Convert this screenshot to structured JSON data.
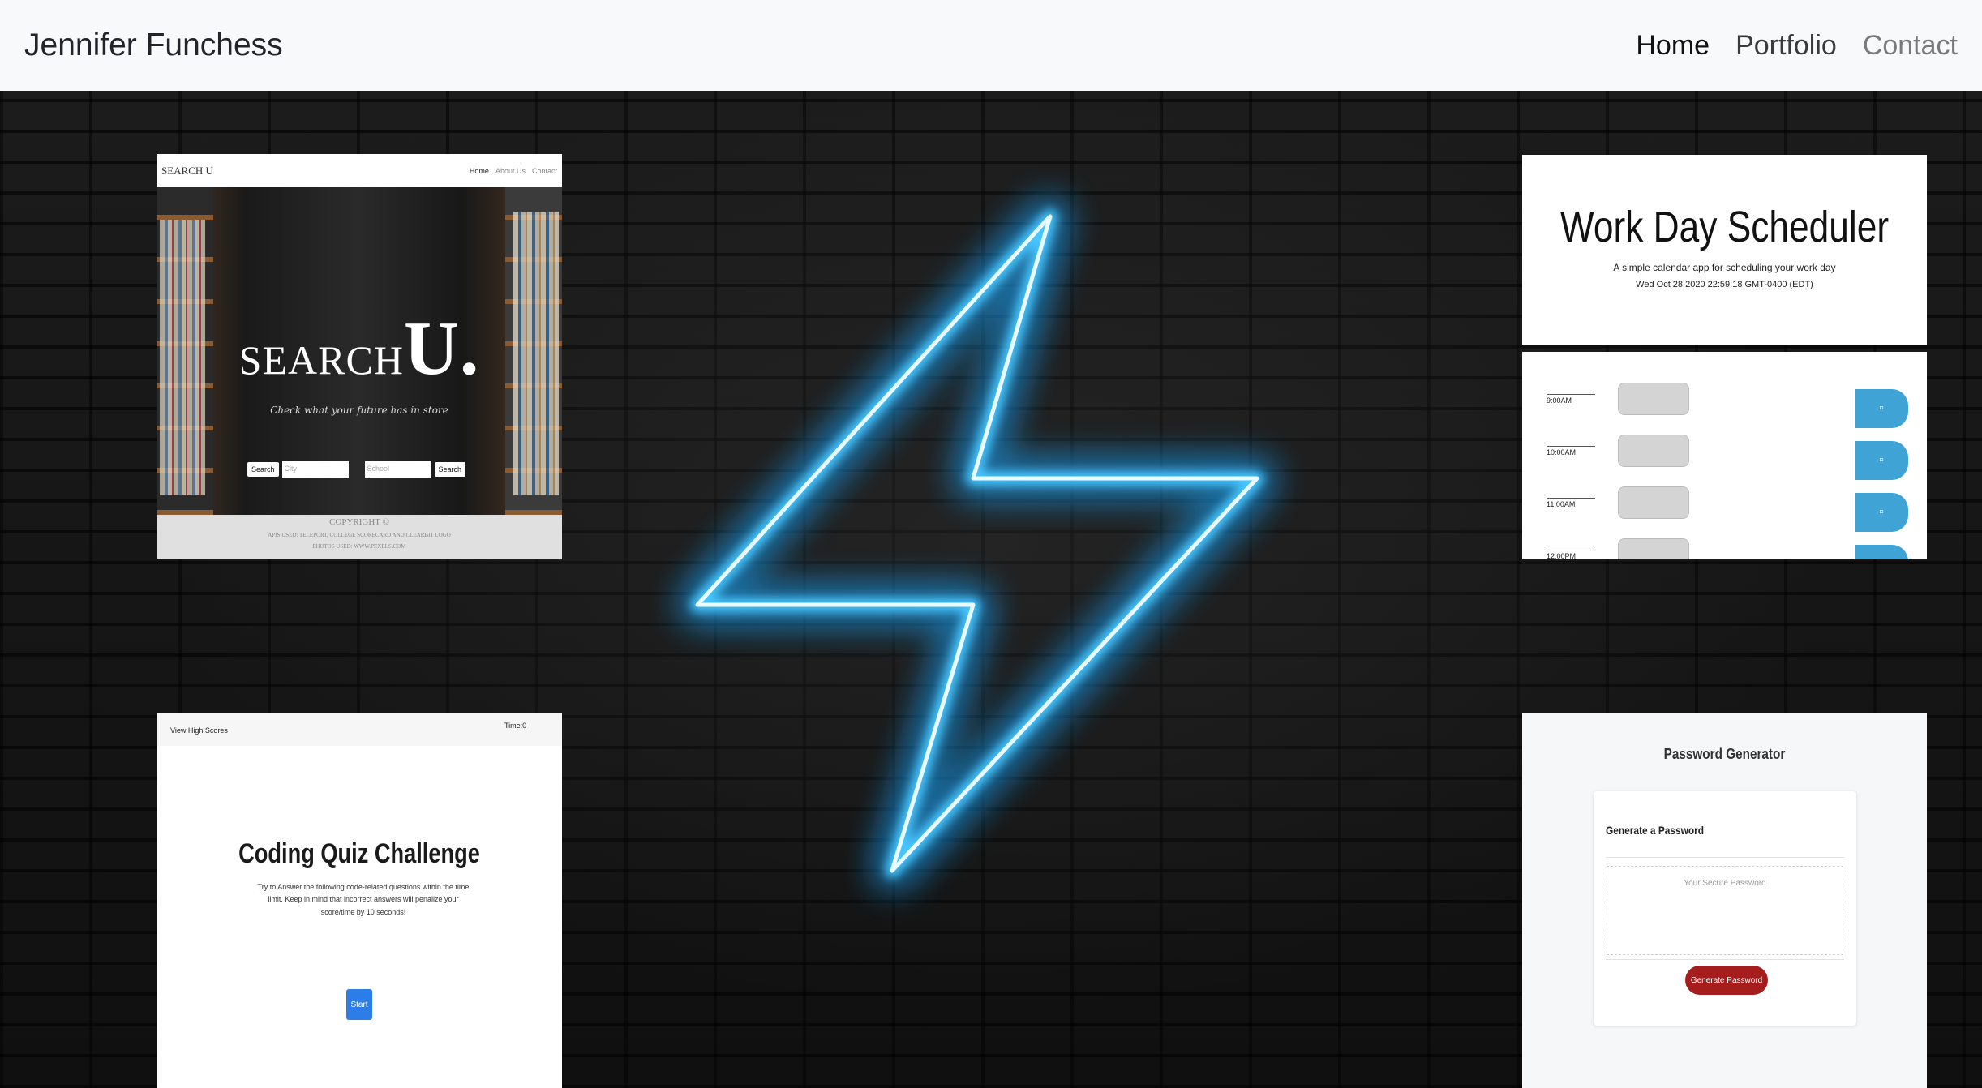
{
  "navbar": {
    "brand": "Jennifer Funchess",
    "links": [
      "Home",
      "Portfolio",
      "Contact"
    ]
  },
  "hero": {
    "bolt_color": "#4fc8ff"
  },
  "projects": {
    "search_u": {
      "brand": "SEARCH U",
      "nav": [
        "Home",
        "About Us",
        "Contact"
      ],
      "logo_text": "SEARCH",
      "logo_big": "U.",
      "tagline": "Check what your future has in store",
      "search_button": "Search",
      "city_placeholder": "City",
      "school_placeholder": "School",
      "search_button2": "Search",
      "copyright": "COPYRIGHT ©",
      "footer_line1": "APIS USED: TELEPORT, COLLEGE SCORECARD AND CLEARBIT LOGO",
      "footer_line2": "PHOTOS USED: WWW.PEXELS.COM"
    },
    "scheduler": {
      "title": "Work Day Scheduler",
      "subtitle": "A simple calendar app for scheduling your work day",
      "date": "Wed Oct 28 2020 22:59:18 GMT-0400 (EDT)",
      "hours": [
        "9:00AM",
        "10:00AM",
        "11:00AM",
        "12:00PM"
      ]
    },
    "quiz": {
      "view_high_scores": "View High Scores",
      "time": "Time:0",
      "title": "Coding Quiz Challenge",
      "description": "Try to Answer the following code-related questions within the time limit. Keep in mind that incorrect answers will penalize your score/time by 10 seconds!",
      "start": "Start"
    },
    "password": {
      "title": "Password Generator",
      "card_header": "Generate a Password",
      "placeholder": "Your Secure Password",
      "button": "Generate Password"
    }
  }
}
